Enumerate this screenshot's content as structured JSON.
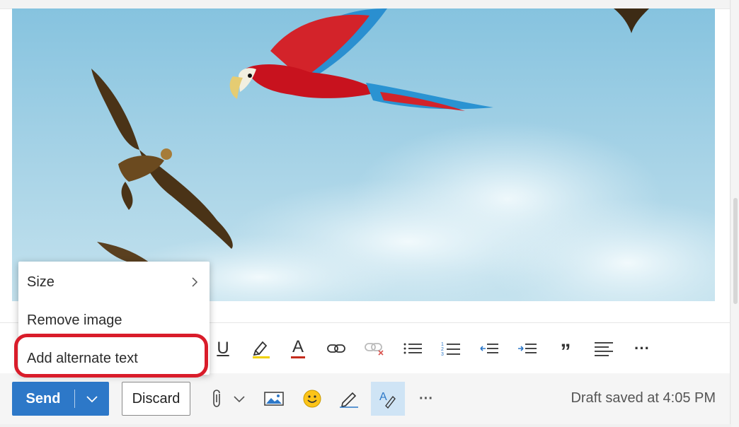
{
  "context_menu": {
    "size_label": "Size",
    "remove_image_label": "Remove image",
    "add_alt_text_label": "Add alternate text"
  },
  "format_toolbar": {
    "underline_glyph": "U",
    "font_color_glyph": "A",
    "quote_glyph": "”",
    "more_glyph": "···"
  },
  "actions": {
    "send_label": "Send",
    "discard_label": "Discard",
    "more_glyph": "···",
    "draft_status": "Draft saved at 4:05 PM"
  },
  "colors": {
    "accent": "#2d78c8",
    "highlight_ring": "#d91c2a",
    "active_button": "#cfe4f5"
  },
  "icons": [
    "chevron-right-icon",
    "highlighter-icon",
    "link-icon",
    "unlink-icon",
    "bullet-list-icon",
    "numbered-list-icon",
    "decrease-indent-icon",
    "increase-indent-icon",
    "align-left-icon",
    "chevron-down-icon",
    "paperclip-icon",
    "picture-icon",
    "emoji-icon",
    "signature-icon",
    "editor-icon"
  ]
}
